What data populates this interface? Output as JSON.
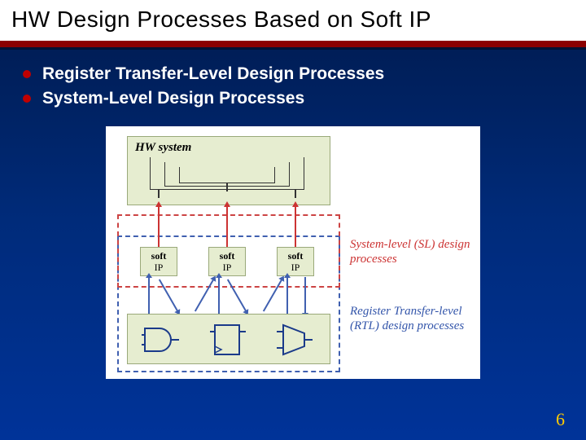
{
  "title": "HW Design Processes Based on Soft IP",
  "bullets": [
    "Register Transfer-Level Design Processes",
    "System-Level Design Processes"
  ],
  "diagram": {
    "hw_label": "HW system",
    "ip_label_soft": "soft",
    "ip_label_ip": "IP",
    "sl_caption": "System-level (SL) design processes",
    "rtl_caption": "Register Transfer-level (RTL) design processes"
  },
  "page_number": "6"
}
